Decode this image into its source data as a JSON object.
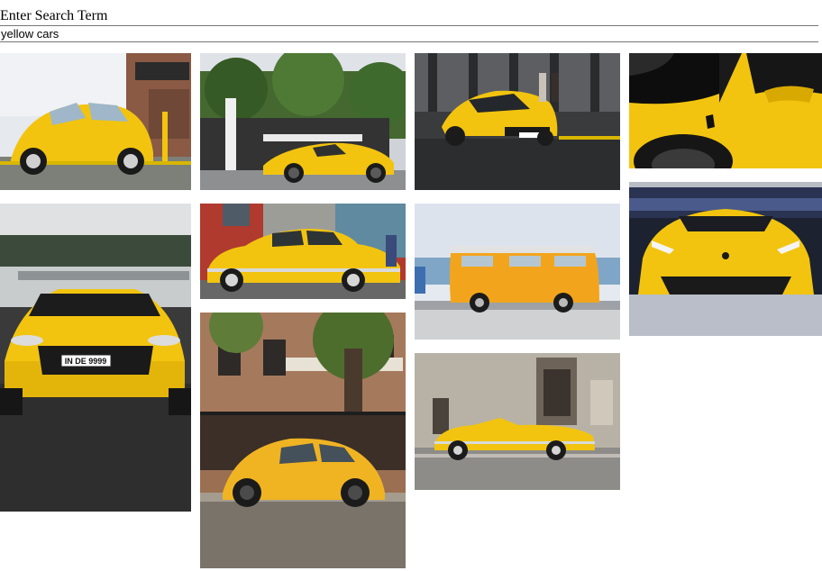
{
  "search": {
    "label": "Enter Search Term",
    "value": "yellow cars"
  },
  "results": [
    {
      "id": "beetle-street",
      "desc": "yellow beetle on street"
    },
    {
      "id": "porsche-cayman",
      "desc": "yellow sports car in front of restaurant"
    },
    {
      "id": "amg-gt-wet",
      "desc": "yellow mercedes on wet street"
    },
    {
      "id": "ferrari-closeup",
      "desc": "yellow ferrari side closeup"
    },
    {
      "id": "audi-r8",
      "desc": "yellow audi r8 front"
    },
    {
      "id": "chevy-classic",
      "desc": "classic yellow car on street"
    },
    {
      "id": "vw-bus",
      "desc": "yellow vw bus"
    },
    {
      "id": "lamborghini-huracan",
      "desc": "yellow lamborghini at show"
    },
    {
      "id": "beetle-tree",
      "desc": "yellow beetle under tree"
    },
    {
      "id": "classic-convertible",
      "desc": "yellow convertible in front of old building"
    }
  ],
  "plate_text": {
    "audi": "IN DE 9999"
  },
  "colors": {
    "yellow": "#f2c40f",
    "yellow_dark": "#c99a00",
    "input_border": "#767676"
  }
}
